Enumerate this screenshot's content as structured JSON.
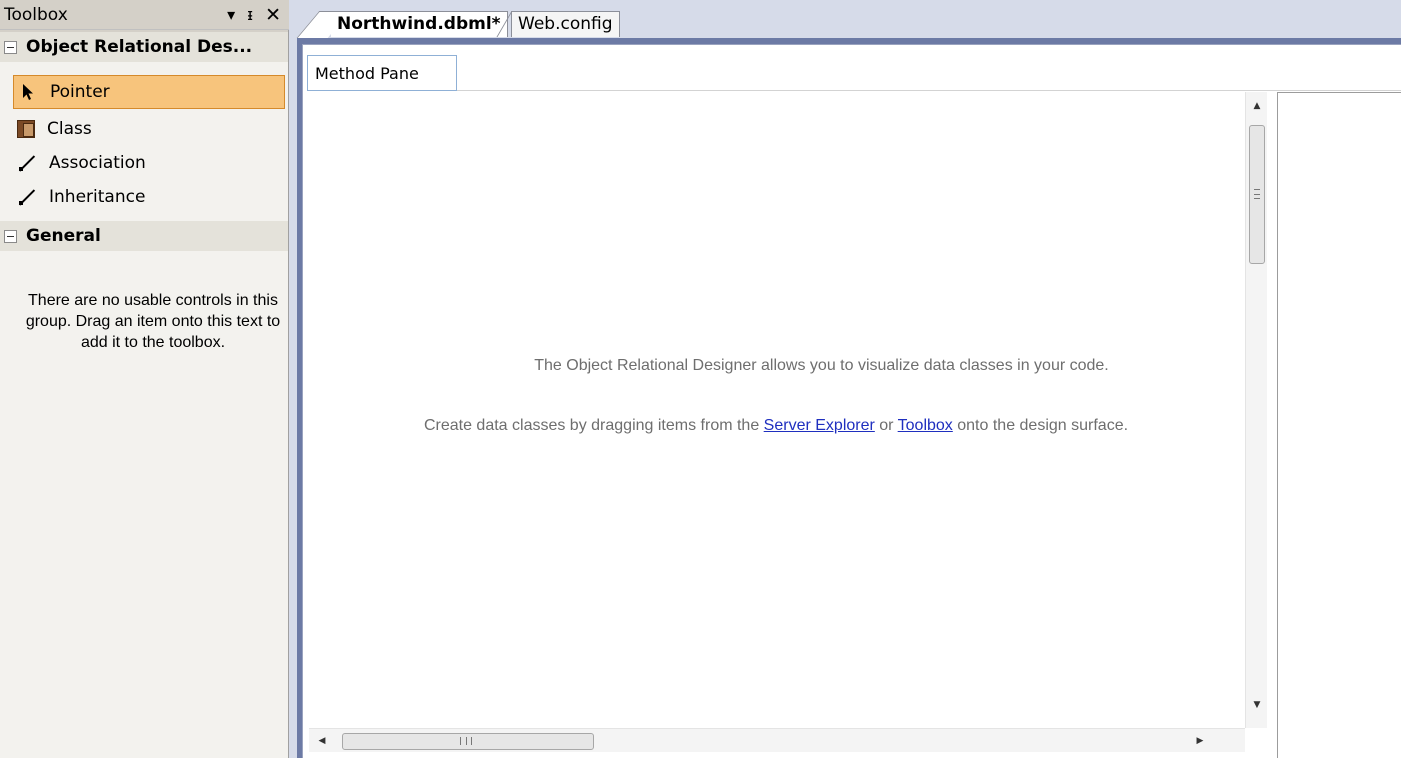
{
  "toolbox": {
    "title": "Toolbox",
    "header_buttons": {
      "dropdown": "▾",
      "pin": "ᵻ",
      "close": "✕"
    },
    "groups": [
      {
        "label": "Object Relational Des...",
        "items": [
          {
            "label": "Pointer",
            "icon": "pointer-icon",
            "selected": true
          },
          {
            "label": "Class",
            "icon": "class-icon"
          },
          {
            "label": "Association",
            "icon": "association-icon"
          },
          {
            "label": "Inheritance",
            "icon": "inheritance-icon"
          }
        ]
      },
      {
        "label": "General",
        "empty_text": "There are no usable controls in this group. Drag an item onto this text to add it to the toolbox."
      }
    ]
  },
  "tabs": [
    {
      "label": "Northwind.dbml*",
      "active": true
    },
    {
      "label": "Web.config",
      "active": false
    }
  ],
  "designer": {
    "method_pane_tab": "Method Pane",
    "message_1": "The Object Relational Designer allows you to visualize data classes in your code.",
    "message_2_before": "Create data classes by dragging items from the ",
    "link_server_explorer": "Server Explorer",
    "message_2_middle": " or ",
    "link_toolbox": "Toolbox",
    "message_2_after": " onto the design surface."
  },
  "scrollbars": {
    "up": "▲",
    "down": "▼",
    "left": "◀",
    "right": "▶"
  },
  "colors": {
    "selection_fill": "#f7c47c",
    "selection_border": "#d58a2b",
    "link": "#1f2fbf",
    "doc_frame": "#6c7aa5"
  }
}
